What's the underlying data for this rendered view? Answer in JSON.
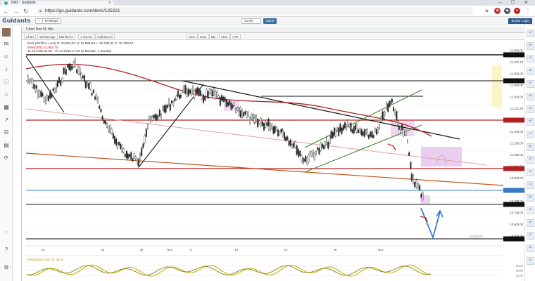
{
  "browser": {
    "tab_title": "DAX · Guidants",
    "url": "https://go.guidants.com/de#c/125221",
    "window_buttons": "–  ☐  ✕"
  },
  "app": {
    "logo": "Guidants",
    "desktop_label": "Desktops",
    "search_label": "Suche",
    "markt_label": "Markt",
    "broker_login": "Broker Login"
  },
  "chart": {
    "window_title": "Chart Dax 60 Min.",
    "toolbar": [
      "Chart",
      "Werkzeuge",
      "Markieren",
      "1 Woche",
      "Indikatoren",
      "SMA",
      "EMA",
      "BB",
      "SMA",
      "ATR"
    ],
    "info_line1": "DAX (XETRA, Last)  O: 10.882,97  H: 10.888,90  L: 10.788,04  C: 10.788,04",
    "info_line2": "EMA(200): 11.052,70",
    "info_line3": "11.10.2018 11:00 - 27.12.2018 17:00 (2 Monate, 1 Stunde)",
    "oscillator_label": "STOCH(14,3) (5, 5): 44,37",
    "watermark": "Guidants",
    "price_labels": [
      "11.800,00",
      "11.667,70",
      "11.600,00",
      "11.500,00",
      "11.400,00",
      "11.331,20",
      "11.300,00",
      "11.200,00",
      "11.100,00",
      "11.050,00",
      "11.000,00",
      "10.900,00",
      "10.800,00",
      "10.788,04",
      "10.700,00",
      "10.600,00",
      "10.500,00"
    ],
    "date_labels": [
      "15",
      "22",
      "29",
      "Nov",
      "5",
      "12",
      "19",
      "26",
      "Dez"
    ],
    "osc_ticks": [
      "80,00",
      "50,00",
      "20,00"
    ]
  },
  "colors": {
    "candle": "#2b2b2b",
    "ema": "#b02020",
    "trend_black": "#111111",
    "channel_green": "#3a8a2a",
    "support_orange": "#c0541a",
    "zone_pink": "#e8c6ec",
    "zone_yellow": "#fbf6c8",
    "projection_blue": "#1f6fd0",
    "stoch_yellow": "#d4b000",
    "stoch_olive": "#7a8a1a"
  }
}
